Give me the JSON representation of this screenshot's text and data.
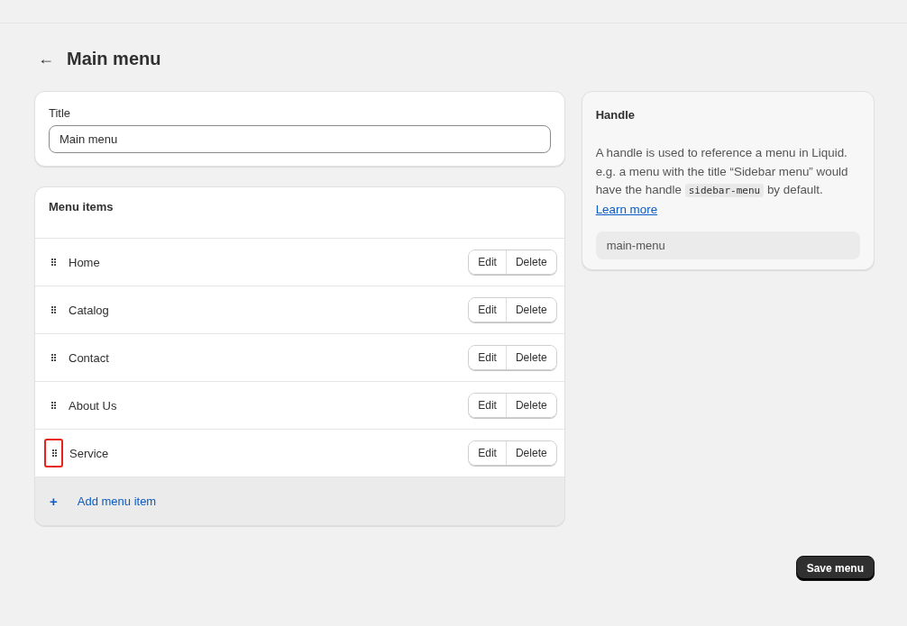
{
  "header": {
    "back": "←",
    "title": "Main menu"
  },
  "title_card": {
    "label": "Title",
    "value": "Main menu"
  },
  "menu_items": {
    "heading": "Menu items",
    "items": [
      {
        "label": "Home",
        "highlighted": false,
        "actions": [
          "Edit",
          "Delete"
        ]
      },
      {
        "label": "Catalog",
        "highlighted": false,
        "actions": [
          "Edit",
          "Delete"
        ]
      },
      {
        "label": "Contact",
        "highlighted": false,
        "actions": [
          "Edit",
          "Delete"
        ]
      },
      {
        "label": "About Us",
        "highlighted": false,
        "actions": [
          "Edit",
          "Delete"
        ]
      },
      {
        "label": "Service",
        "highlighted": true,
        "actions": [
          "Edit",
          "Delete"
        ]
      }
    ],
    "add": {
      "icon": "+",
      "label": "Add menu item"
    }
  },
  "handle_card": {
    "heading": "Handle",
    "text_before": "A handle is used to reference a menu in Liquid. e.g. a menu with the title “Sidebar menu” would have the handle",
    "code": "sidebar-menu",
    "text_after": "by default.",
    "link": "Learn more",
    "value": "main-menu"
  },
  "save_button": "Save menu"
}
